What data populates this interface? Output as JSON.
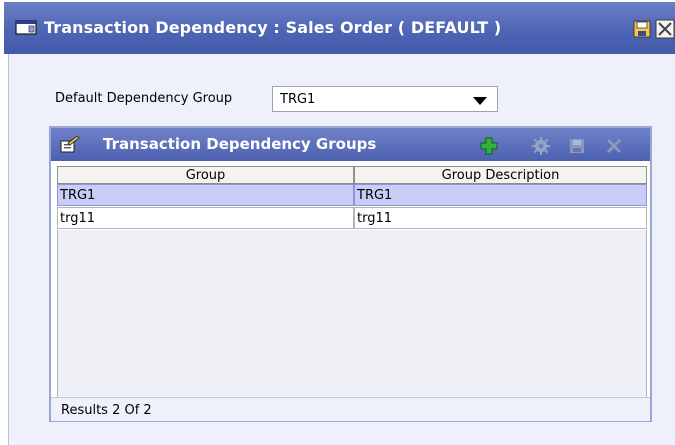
{
  "window": {
    "title": "Transaction Dependency : Sales Order ( DEFAULT )",
    "icons": [
      "window-icon",
      "save-icon",
      "close-icon"
    ]
  },
  "form": {
    "dependency_label": "Default Dependency Group",
    "dependency_value": "TRG1"
  },
  "panel": {
    "title": "Transaction Dependency Groups",
    "toolbar_icons": [
      "add-icon",
      "details-icon",
      "save-icon",
      "delete-icon"
    ],
    "columns": [
      "Group",
      "Group Description"
    ],
    "rows": [
      {
        "group": "TRG1",
        "description": "TRG1"
      },
      {
        "group": "trg11",
        "description": "trg11"
      }
    ],
    "results_text": "Results 2  Of 2"
  },
  "colors": {
    "title_bar": "#4d63b3",
    "selected_row": "#c9cdf6",
    "body_bg": "#eef1fb"
  }
}
